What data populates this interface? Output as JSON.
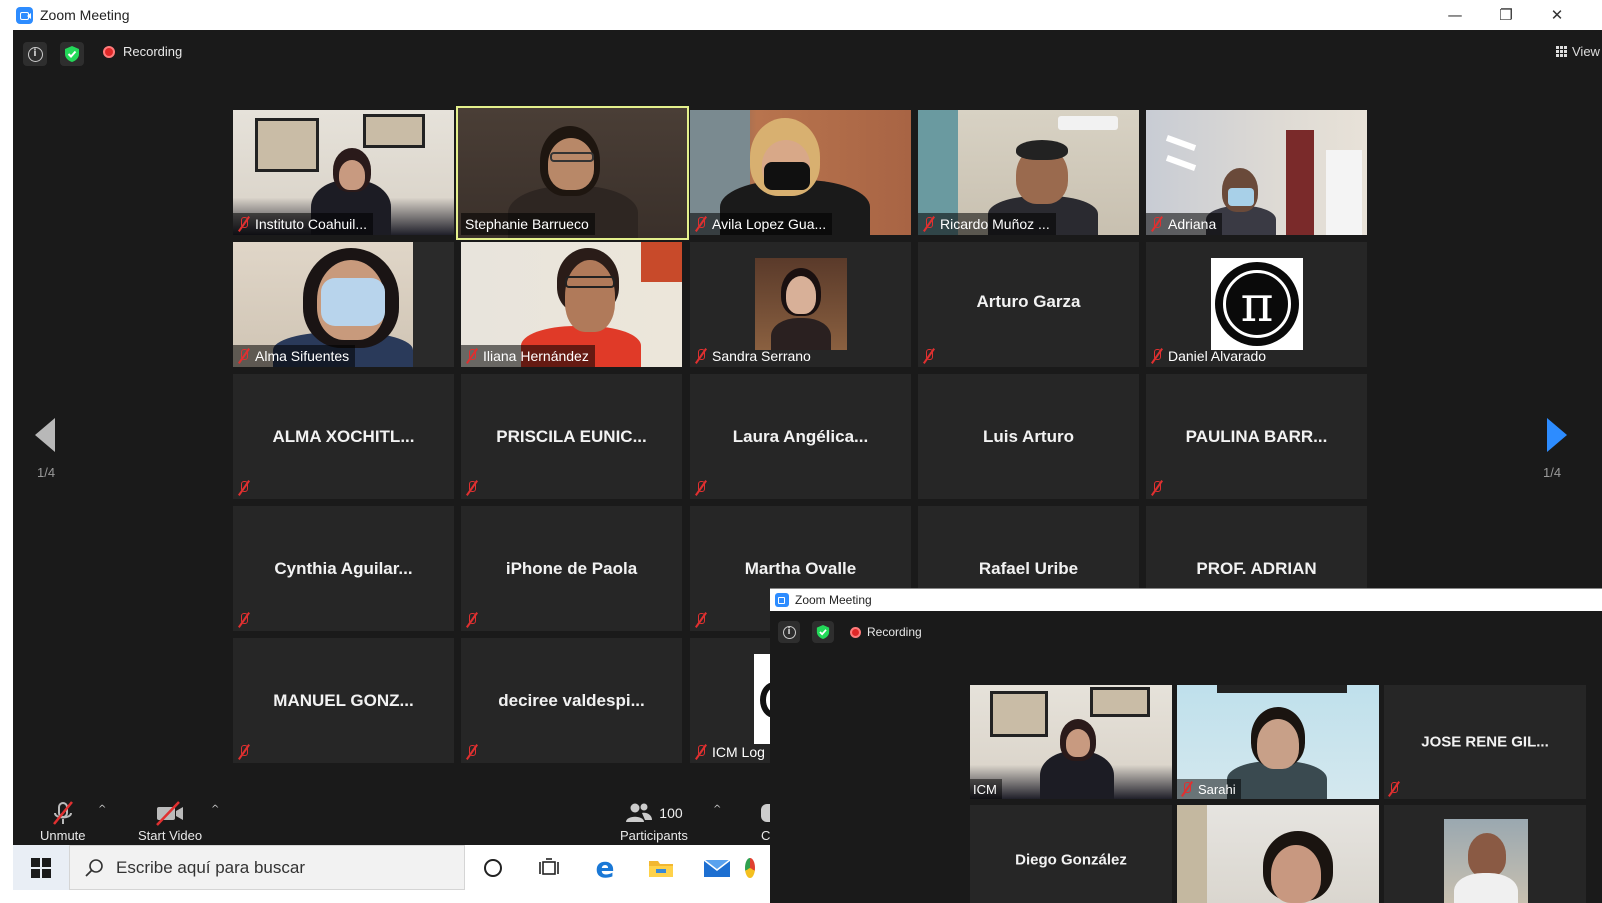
{
  "window": {
    "title": "Zoom Meeting",
    "controls": {
      "minimize": "—",
      "restore": "❐",
      "close": "✕"
    }
  },
  "topbar": {
    "recording_label": "Recording",
    "view_label": "View"
  },
  "pagination": {
    "left": "1/4",
    "right": "1/4"
  },
  "tiles": [
    {
      "name": "Instituto Coahuil..."
    },
    {
      "name": "Stephanie Barrueco"
    },
    {
      "name": "Avila Lopez Gua..."
    },
    {
      "name": "Ricardo Muñoz ..."
    },
    {
      "name": "Adriana"
    },
    {
      "name": "Alma Sifuentes"
    },
    {
      "name": "Iliana Hernández"
    },
    {
      "name": "Sandra Serrano"
    },
    {
      "name": "Arturo Garza"
    },
    {
      "name": "Daniel Alvarado"
    },
    {
      "name": "ALMA  XOCHITL..."
    },
    {
      "name": "PRISCILA  EUNIC..."
    },
    {
      "name": "Laura  Angélica..."
    },
    {
      "name": "Luis Arturo"
    },
    {
      "name": "PAULINA BARR..."
    },
    {
      "name": "Cynthia  Aguilar..."
    },
    {
      "name": "iPhone de Paola"
    },
    {
      "name": "Martha Ovalle"
    },
    {
      "name": "Rafael Uribe"
    },
    {
      "name": "PROF. ADRIAN"
    },
    {
      "name": "MANUEL  GONZ..."
    },
    {
      "name": "deciree  valdespi..."
    },
    {
      "name": "ICM Log"
    }
  ],
  "toolbar": {
    "unmute_label": "Unmute",
    "start_video_label": "Start Video",
    "participants_label": "Participants",
    "participants_count": "100",
    "chat_label_partial": "C"
  },
  "taskbar": {
    "search_placeholder": "Escribe aquí para buscar"
  },
  "second_window": {
    "title": "Zoom Meeting",
    "recording_label": "Recording",
    "tiles": [
      {
        "name": "ICM"
      },
      {
        "name": "Sarahi"
      },
      {
        "name": "JOSE RENE GIL..."
      },
      {
        "name": "Diego González"
      }
    ]
  },
  "colors": {
    "zoom_blue": "#2d8cff",
    "meeting_bg": "#1a1a1a",
    "tile_bg": "#262626",
    "active_speaker": "#e4f08c",
    "muted_red": "#e03030",
    "recording_red": "#e02828",
    "security_green": "#23d959"
  }
}
